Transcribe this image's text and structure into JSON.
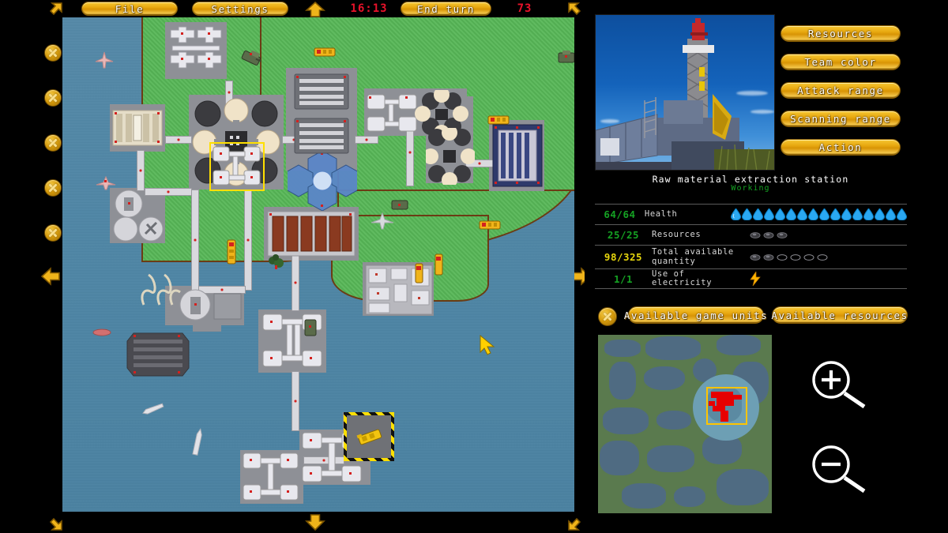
{
  "topbar": {
    "file_label": "File",
    "settings_label": "Settings",
    "clock": "16:13",
    "end_turn_label": "End turn",
    "turn_count": "73",
    "scroll_up_icon": "arrow-up-icon",
    "scroll_corner_icon": "arrow-corner-icon"
  },
  "map": {
    "cursor_icon": "mouse-cursor",
    "selected_unit_highlight": "yellow-selection-box",
    "target_marker": "hazard-stripe-box"
  },
  "edge_controls": {
    "close_icon": "x-icon",
    "left_arrow_icon": "arrow-left-icon",
    "right_arrow_icon": "arrow-right-icon",
    "down_arrow_icon": "arrow-down-icon",
    "up_arrow_icon": "arrow-up-icon"
  },
  "right_panel": {
    "preview_image_alt": "drilling-rig-photo",
    "buttons": [
      {
        "label": "Resources",
        "name": "resources-button"
      },
      {
        "label": "Team color",
        "name": "team-color-button"
      },
      {
        "label": "Attack range",
        "name": "attack-range-button"
      },
      {
        "label": "Scanning range",
        "name": "scanning-range-button"
      },
      {
        "label": "Action",
        "name": "action-button"
      }
    ],
    "unit_name": "Raw material extraction station",
    "unit_state": "Working",
    "state_color": "#15a223"
  },
  "stats": {
    "rows": [
      {
        "value": "64/64",
        "label": "Health",
        "icon": "water-drop-icon",
        "filled": 16,
        "empty": 0,
        "value_color": "#15a223"
      },
      {
        "value": "25/25",
        "label": "Resources",
        "icon": "ore-icon",
        "filled": 3,
        "empty": 0,
        "value_color": "#15a223"
      },
      {
        "value": "98/325",
        "label": "Total available quantity",
        "icon": "ore-icon",
        "filled": 2,
        "empty": 4,
        "value_color": "#e6d60d"
      },
      {
        "value": "1/1",
        "label": "Use of electricity",
        "icon": "lightning-bolt-icon",
        "filled": 1,
        "empty": 0,
        "value_color": "#15a223"
      }
    ]
  },
  "action_row": {
    "close_icon": "x-icon",
    "units_label": "Available game units",
    "resources_label": "Available resources"
  },
  "minimap": {
    "name": "world-minimap",
    "viewport_box_color": "#ffc400",
    "owned_territory_color": "#e60000",
    "zoom_in_icon": "magnifier-plus-icon",
    "zoom_out_icon": "magnifier-minus-icon"
  },
  "colors": {
    "gold": "#e8a911",
    "red_text": "#e8122a",
    "green_text": "#15a223",
    "yellow_text": "#e6d60d",
    "water": "#4e86a6",
    "land": "#57b757"
  }
}
